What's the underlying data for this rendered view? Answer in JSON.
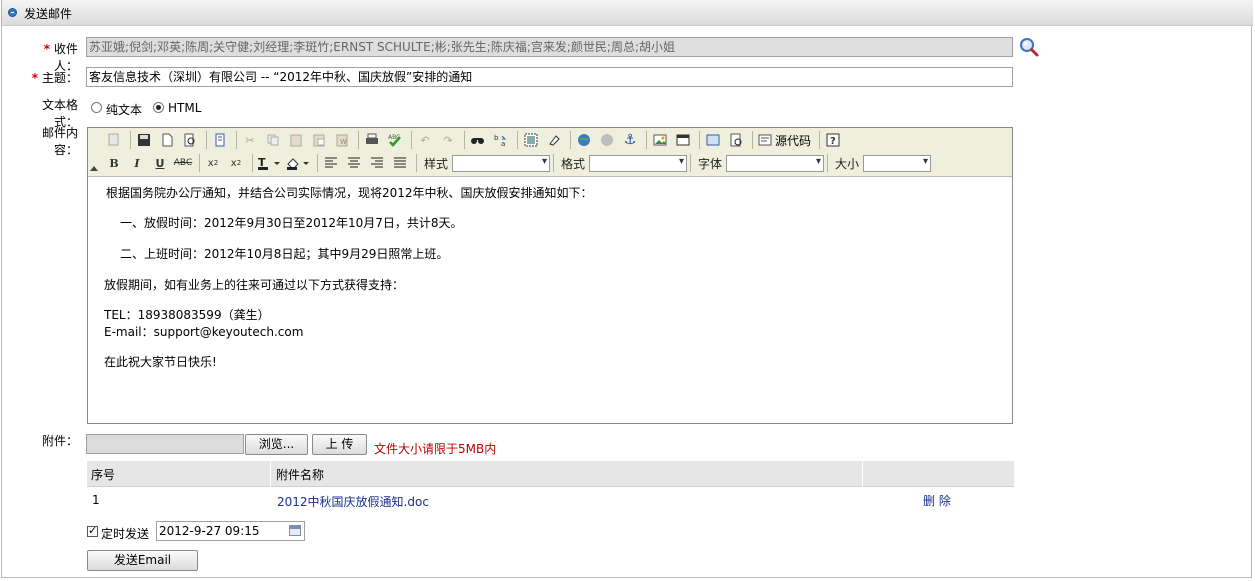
{
  "window": {
    "title": "发送邮件"
  },
  "form": {
    "recipients_label": "收件人：",
    "recipients_value": "苏亚娥;倪剑;邓英;陈周;关守健;刘经理;李斑竹;ERNST SCHULTE;彬;张先生;陈庆福;宫来发;颜世民;周总;胡小姐",
    "subject_label": "主题：",
    "subject_value": "客友信息技术（深圳）有限公司 -- “2012年中秋、国庆放假”安排的通知",
    "format_label": "文本格式：",
    "format_plain": "纯文本",
    "format_html": "HTML",
    "format_selected": "HTML",
    "content_label": "邮件内容：",
    "attach_label": "附件："
  },
  "editor": {
    "toolbar": {
      "source_label": "源代码",
      "style_label": "样式",
      "format_label": "格式",
      "font_label": "字体",
      "size_label": "大小"
    },
    "body": [
      "根据国务院办公厅通知，并结合公司实际情况，现将2012年中秋、国庆放假安排通知如下：",
      "一、放假时间：2012年9月30日至2012年10月7日，共计8天。",
      "二、上班时间：2012年10月8日起；其中9月29日照常上班。",
      "放假期间，如有业务上的往来可通过以下方式获得支持：",
      "TEL：18938083599（龚生）",
      "E-mail：support@keyoutech.com",
      "在此祝大家节日快乐!"
    ]
  },
  "attachments": {
    "browse_label": "浏览...",
    "upload_label": "上 传",
    "size_note": "文件大小请限于5MB内",
    "columns": [
      "序号",
      "附件名称"
    ],
    "rows": [
      {
        "index": "1",
        "name": "2012中秋国庆放假通知.doc",
        "action": "删 除"
      }
    ]
  },
  "schedule": {
    "label": "定时发送",
    "checked": true,
    "datetime": "2012-9-27 09:15"
  },
  "send_button": "发送Email"
}
